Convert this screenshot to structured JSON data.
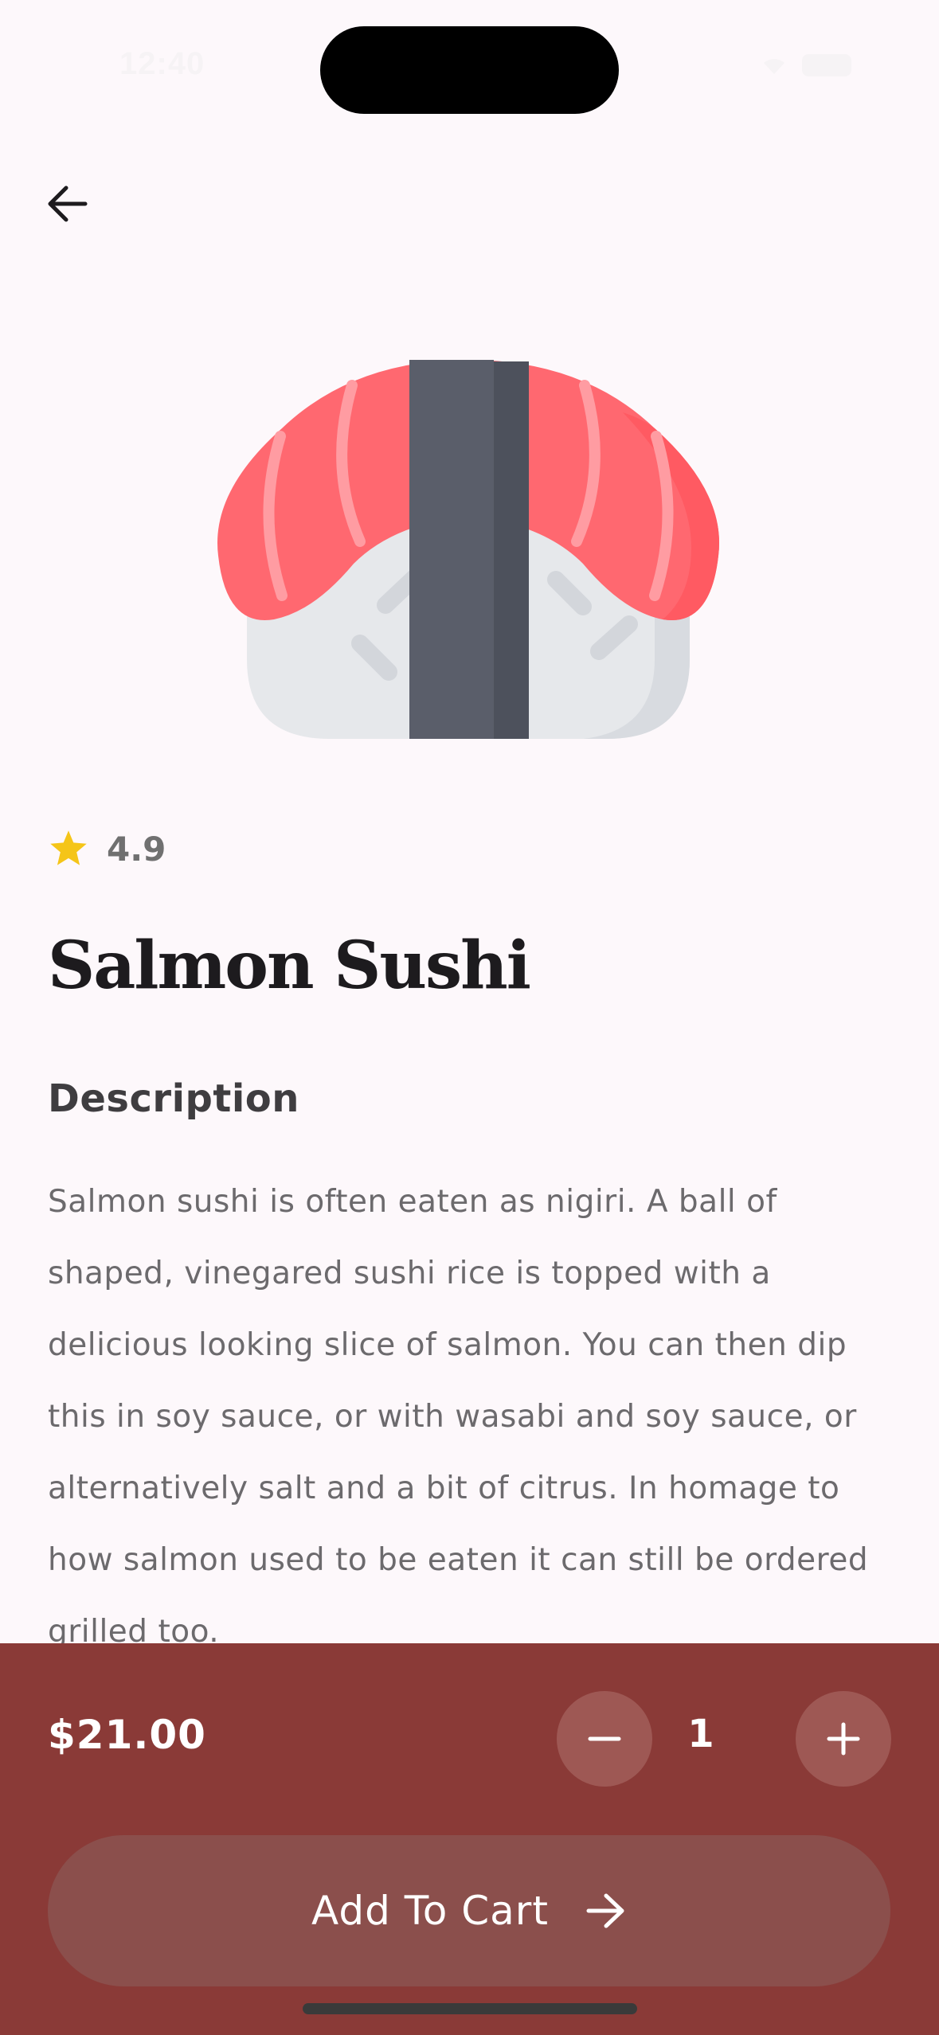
{
  "status_bar": {
    "time": "12:40"
  },
  "navigation": {
    "back_icon": "arrow-left-icon"
  },
  "food": {
    "image_icon": "salmon-nigiri-illustration",
    "rating": "4.9",
    "rating_icon": "star-icon",
    "name": "Salmon Sushi",
    "description_heading": "Description",
    "description": "Salmon sushi is often eaten as nigiri. A ball of shaped, vinegared sushi rice is topped with a delicious looking slice of salmon. You can then dip this in soy sauce, or with wasabi and soy sauce, or alternatively salt and a bit of citrus. In homage to how salmon used to be eaten it can still be ordered grilled too."
  },
  "purchase": {
    "price": "$21.00",
    "quantity": "1",
    "decrement_icon": "minus-icon",
    "increment_icon": "plus-icon",
    "add_to_cart_label": "Add To Cart",
    "add_to_cart_icon": "arrow-right-icon"
  },
  "colors": {
    "background": "#fdf8fb",
    "panel": "#8a3a37",
    "panel_button": "#9e5854",
    "cart_button": "#8b4f4c",
    "star": "#f5c518",
    "salmon": "#ff6870",
    "nori": "#5a5e6a",
    "rice": "#e6e8eb"
  }
}
